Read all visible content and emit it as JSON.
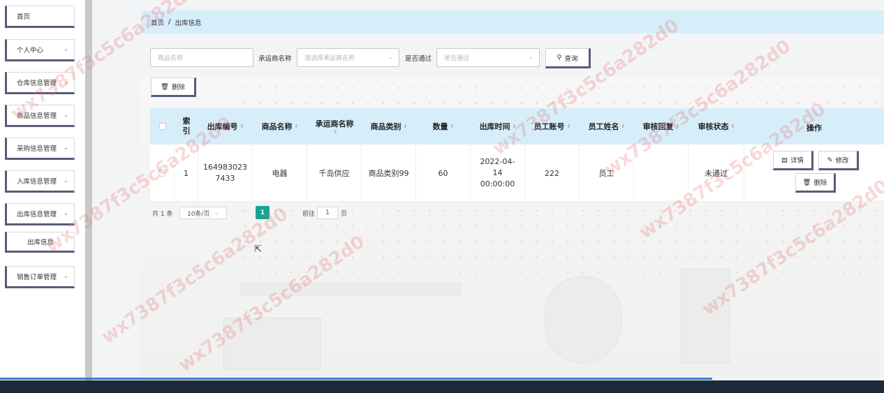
{
  "sidebar": {
    "items": [
      {
        "label": "首页",
        "has_children": false
      },
      {
        "label": "个人中心",
        "has_children": true
      },
      {
        "label": "仓库信息管理",
        "has_children": true
      },
      {
        "label": "商品信息管理",
        "has_children": true
      },
      {
        "label": "采购信息管理",
        "has_children": true
      },
      {
        "label": "入库信息管理",
        "has_children": true
      },
      {
        "label": "出库信息管理",
        "has_children": true
      },
      {
        "label": "出库信息",
        "has_children": false,
        "sub": true
      },
      {
        "label": "销售订单管理",
        "has_children": true
      }
    ]
  },
  "breadcrumb": {
    "home": "首页",
    "separator": "/",
    "current": "出库信息"
  },
  "search": {
    "product_placeholder": "商品名称",
    "carrier_label": "承运商名称",
    "carrier_placeholder": "请选择承运商名称",
    "passed_label": "是否通过",
    "passed_placeholder": "是否通过",
    "query_button": "查询",
    "delete_button": "删除"
  },
  "table": {
    "columns": [
      "索引",
      "出库编号",
      "商品名称",
      "承运商名称",
      "商品类别",
      "数量",
      "出库时间",
      "员工账号",
      "员工姓名",
      "审核回复",
      "审核状态",
      "操作"
    ],
    "rows": [
      {
        "index": "1",
        "outbound_no": "1649830237433",
        "product_name": "电器",
        "carrier": "千岛供应",
        "category": "商品类别99",
        "quantity": "60",
        "outbound_time": "2022-04-14 00:00:00",
        "staff_account": "222",
        "staff_name": "员工",
        "review_reply": "",
        "review_status": "未通过"
      }
    ],
    "actions": {
      "detail": "详情",
      "edit": "修改",
      "delete": "删除"
    }
  },
  "pagination": {
    "total": "共 1 条",
    "page_size": "10条/页",
    "current_page": "1",
    "goto_label": "前往",
    "goto_value": "1",
    "page_suffix": "页"
  },
  "watermark": "wx7387f3c5c6a282d0",
  "colors": {
    "header_bg": "#d6eefa",
    "pager_active": "#1aa394",
    "button_shadow": "#5a5a7a"
  }
}
